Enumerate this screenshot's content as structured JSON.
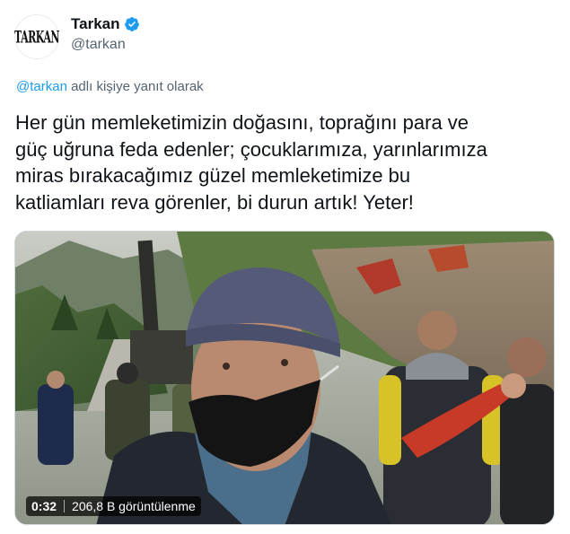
{
  "author": {
    "display_name": "Tarkan",
    "handle": "@tarkan",
    "avatar_logo": "TARKAN",
    "verified": true,
    "verified_icon": "verified-badge-icon"
  },
  "reply_context": {
    "mention": "@tarkan",
    "suffix": " adlı kişiye yanıt olarak"
  },
  "tweet": {
    "lines": [
      "Her gün memleketimizin doğasını, toprağını para ve",
      "güç uğruna feda edenler; çocuklarımıza, yarınlarımıza",
      "miras bırakacağımız güzel memleketimize bu",
      "katliamları reva görenler, bi durun artık! Yeter!"
    ]
  },
  "video": {
    "duration": "0:32",
    "views": "206,8 B görüntülenme"
  },
  "colors": {
    "link": "#1d9bf0",
    "secondary_text": "#536471",
    "primary_text": "#0f1419"
  }
}
